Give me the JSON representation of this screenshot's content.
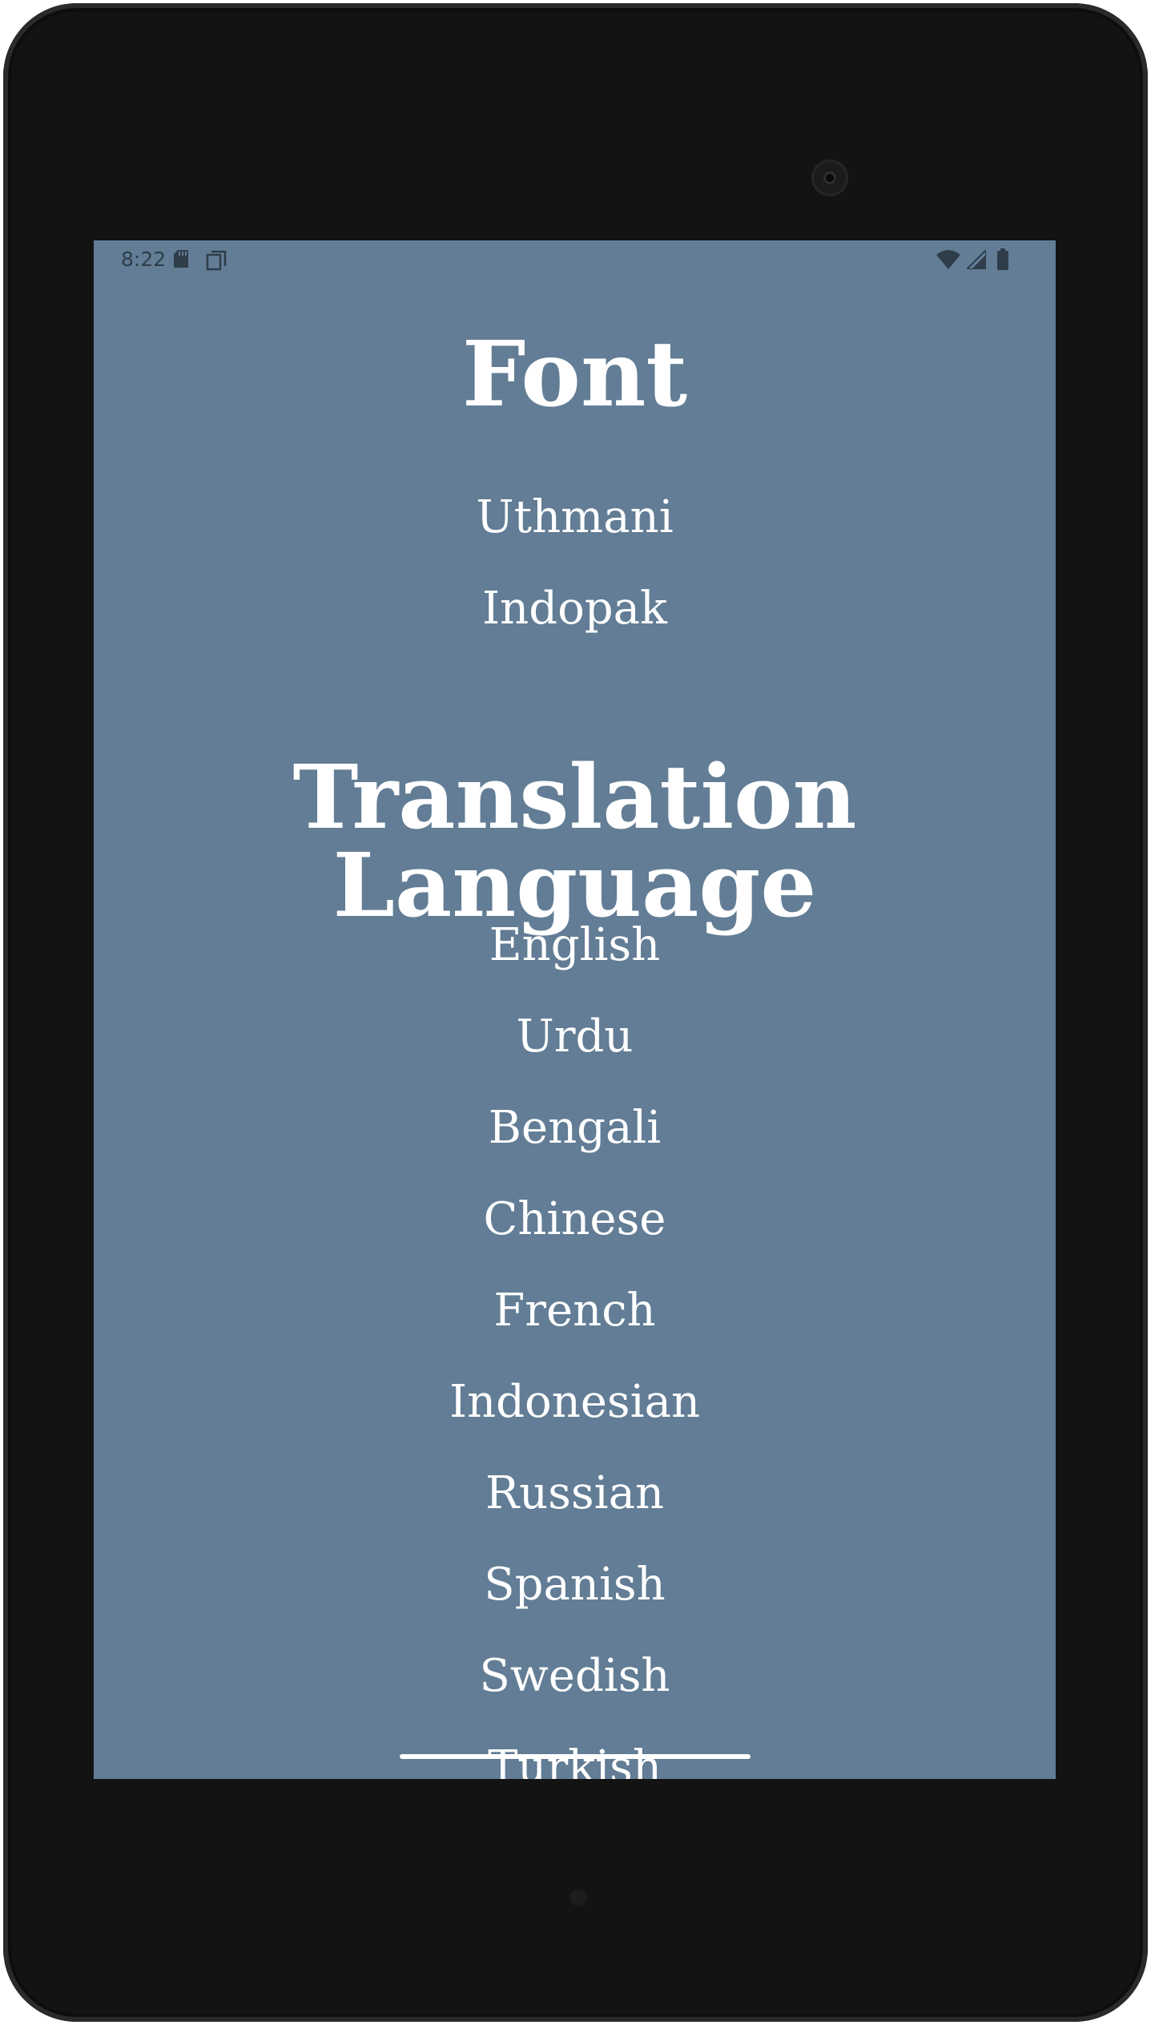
{
  "status_bar": {
    "time": "8:22",
    "icons": [
      "sd-card-icon",
      "copy-icon",
      "wifi-icon",
      "signal-icon",
      "battery-icon"
    ]
  },
  "colors": {
    "screen_background": "#627d95",
    "text": "#ffffff",
    "device_body": "#131313"
  },
  "font_section": {
    "title": "Font",
    "options": [
      "Uthmani",
      "Indopak"
    ]
  },
  "translation_section": {
    "title": "Translation Language",
    "options": [
      "English",
      "Urdu",
      "Bengali",
      "Chinese",
      "French",
      "Indonesian",
      "Russian",
      "Spanish",
      "Swedish",
      "Turkish"
    ]
  }
}
